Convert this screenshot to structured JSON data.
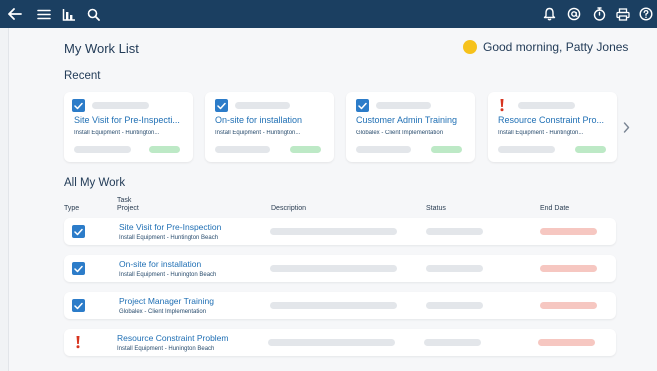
{
  "header": {
    "icons": [
      "back-arrow-icon",
      "menu-icon",
      "chart-icon",
      "search-icon",
      "bell-icon",
      "at-icon",
      "timer-icon",
      "print-icon",
      "help-icon"
    ]
  },
  "page": {
    "title": "My Work List",
    "greeting": "Good morning, Patty Jones"
  },
  "recent": {
    "label": "Recent",
    "cards": [
      {
        "type": "task",
        "title": "Site Visit for Pre-Inspecti...",
        "project": "Install Equipment - Huntington..."
      },
      {
        "type": "task",
        "title": "On-site for installation",
        "project": "Install Equipment - Huntington..."
      },
      {
        "type": "task",
        "title": "Customer Admin Training",
        "project": "Globalex - Client Implementation"
      },
      {
        "type": "alert",
        "title": "Resource Constraint Pro...",
        "project": "Install Equipment - Huntington..."
      }
    ]
  },
  "all_work": {
    "label": "All My Work",
    "columns": {
      "type": "Type",
      "task": "Task",
      "project": "Project",
      "description": "Description",
      "status": "Status",
      "end_date": "End Date"
    },
    "rows": [
      {
        "type": "task",
        "task": "Site Visit for Pre-Inspection",
        "project": "Install Equipment - Huntington Beach"
      },
      {
        "type": "task",
        "task": "On-site for installation",
        "project": "Install Equipment - Hunington Beach"
      },
      {
        "type": "task",
        "task": "Project Manager Training",
        "project": "Globalex - Client Implementation"
      },
      {
        "type": "alert",
        "task": "Resource Constraint Problem",
        "project": "Install Equipment - Hunington Beach"
      }
    ]
  },
  "colors": {
    "header_bg": "#1b3f61",
    "accent_blue": "#2c7cc9",
    "link_blue": "#1f6fb4",
    "status_green": "#bde9c6",
    "date_red": "#f6c7c1",
    "alert_red": "#d7341f",
    "greeting_sun": "#f6c21c"
  }
}
